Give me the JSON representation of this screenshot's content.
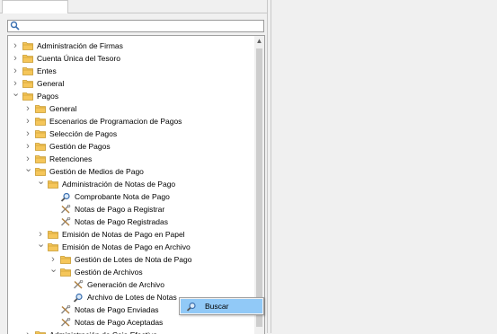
{
  "search": {
    "value": "",
    "placeholder": ""
  },
  "tree": [
    {
      "label": "Administración de Firmas",
      "icon": "folder-icon",
      "arrow": "chevron-right-icon"
    },
    {
      "label": "Cuenta Única del Tesoro",
      "icon": "folder-icon",
      "arrow": "chevron-right-icon"
    },
    {
      "label": "Entes",
      "icon": "folder-icon",
      "arrow": "chevron-right-icon"
    },
    {
      "label": "General",
      "icon": "folder-icon",
      "arrow": "chevron-right-icon"
    },
    {
      "label": "Pagos",
      "icon": "folder-icon",
      "arrow": "chevron-down-icon"
    },
    {
      "label": "General",
      "icon": "folder-icon",
      "arrow": "chevron-right-icon"
    },
    {
      "label": "Escenarios de Programacion de Pagos",
      "icon": "folder-icon",
      "arrow": "chevron-right-icon"
    },
    {
      "label": "Selección de Pagos",
      "icon": "folder-icon",
      "arrow": "chevron-right-icon"
    },
    {
      "label": "Gestión de Pagos",
      "icon": "folder-icon",
      "arrow": "chevron-right-icon"
    },
    {
      "label": "Retenciones",
      "icon": "folder-icon",
      "arrow": "chevron-right-icon"
    },
    {
      "label": "Gestión de Medios de Pago",
      "icon": "folder-icon",
      "arrow": "chevron-down-icon"
    },
    {
      "label": "Administración de Notas de Pago",
      "icon": "folder-icon",
      "arrow": "chevron-down-icon"
    },
    {
      "label": "Comprobante Nota de Pago",
      "icon": "magnifier-icon",
      "arrow": ""
    },
    {
      "label": "Notas de Pago a Registrar",
      "icon": "tools-icon",
      "arrow": ""
    },
    {
      "label": "Notas de Pago Registradas",
      "icon": "tools-icon",
      "arrow": ""
    },
    {
      "label": "Emisión de Notas de Pago en Papel",
      "icon": "folder-icon",
      "arrow": "chevron-right-icon"
    },
    {
      "label": "Emisión de Notas de Pago en Archivo",
      "icon": "folder-icon",
      "arrow": "chevron-down-icon"
    },
    {
      "label": "Gestión de Lotes de Nota de Pago",
      "icon": "folder-icon",
      "arrow": "chevron-right-icon"
    },
    {
      "label": "Gestión de Archivos",
      "icon": "folder-icon",
      "arrow": "chevron-down-icon"
    },
    {
      "label": "Generación de Archivo",
      "icon": "tools-icon",
      "arrow": ""
    },
    {
      "label": "Archivo de Lotes de Notas",
      "icon": "magnifier-icon",
      "arrow": ""
    },
    {
      "label": "Notas de Pago Enviadas",
      "icon": "tools-icon",
      "arrow": ""
    },
    {
      "label": "Notas de Pago Aceptadas",
      "icon": "tools-icon",
      "arrow": ""
    },
    {
      "label": "Administración de Caja Efectivo",
      "icon": "folder-icon",
      "arrow": "chevron-right-icon"
    }
  ],
  "context_menu": {
    "label": "Buscar",
    "icon": "magnifier-icon",
    "highlight": "#91c9f7"
  },
  "colors": {
    "folder": "#f5c65a",
    "folder_stroke": "#c99a2e",
    "tools": "#8a8a8a",
    "magnifier": "#3a6fb0"
  }
}
